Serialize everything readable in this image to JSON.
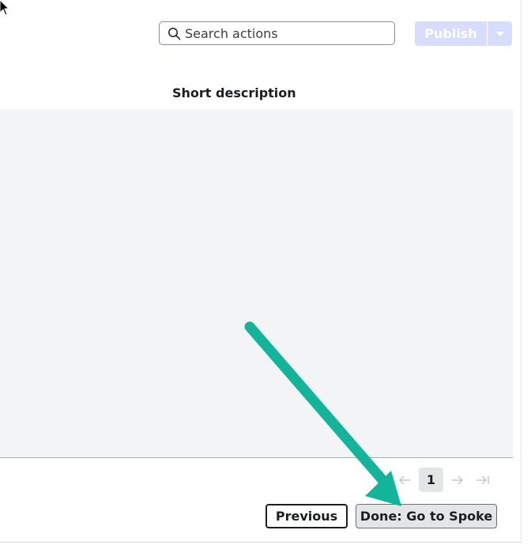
{
  "toolbar": {
    "search_placeholder": "Search actions",
    "publish_label": "Publish"
  },
  "table": {
    "columns": [
      "Short description"
    ]
  },
  "pagination": {
    "current_page": "1"
  },
  "footer": {
    "previous_label": "Previous",
    "done_label": "Done: Go to Spoke"
  },
  "colors": {
    "publish_disabled": "#d7ddfd",
    "annotation_arrow": "#13b59a",
    "table_bg": "#f3f4f6"
  },
  "icons": [
    "cursor-icon",
    "search-icon",
    "caret-down-icon",
    "first-page-arrow-icon",
    "next-page-arrow-icon",
    "last-page-arrow-icon",
    "annotation-arrow"
  ]
}
